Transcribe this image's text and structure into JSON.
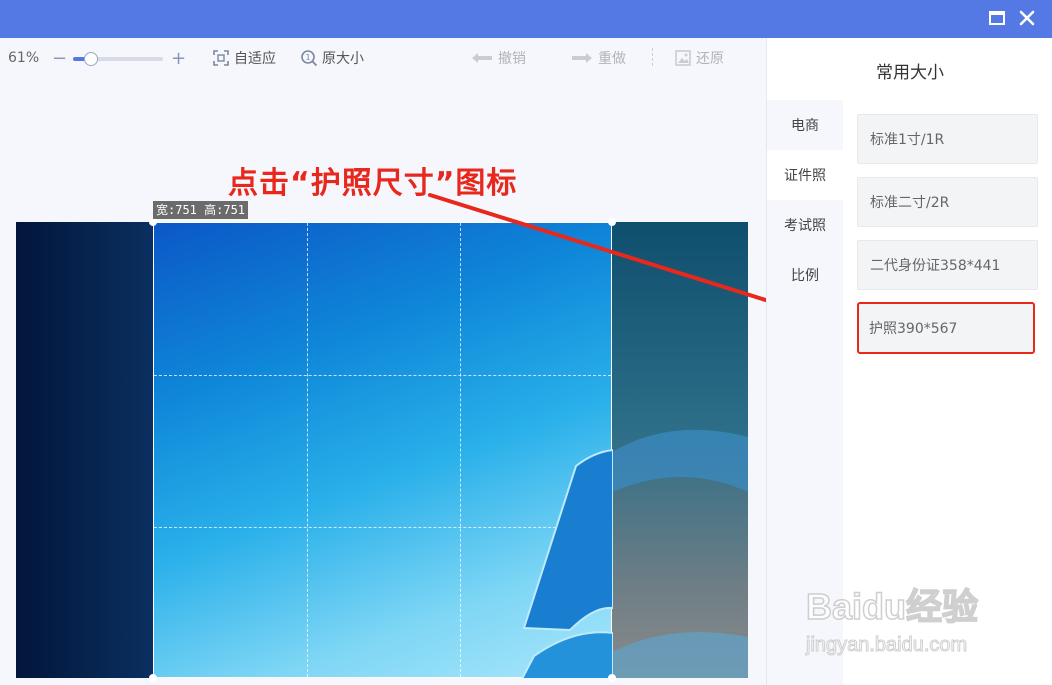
{
  "window": {
    "maximize_icon": "maximize-icon",
    "close_icon": "close-icon"
  },
  "toolbar": {
    "zoom_value": "61%",
    "zoom_fraction": 0.2,
    "zoom_out_symbol": "−",
    "zoom_in_symbol": "+",
    "fit_label": "自适应",
    "original_label": "原大小",
    "undo_label": "撤销",
    "redo_label": "重做",
    "restore_label": "还原"
  },
  "canvas": {
    "crop_size_label": "宽:751 高:751",
    "annotation_text": "点击“护照尺寸”图标",
    "annotation_color": "#e8281d"
  },
  "right_panel": {
    "title": "常用大小",
    "tabs": [
      {
        "label": "电商",
        "active": false
      },
      {
        "label": "证件照",
        "active": true
      },
      {
        "label": "考试照",
        "active": false
      },
      {
        "label": "比例",
        "active": false
      }
    ],
    "sizes": [
      {
        "label": "标准1寸/1R"
      },
      {
        "label": "标准二寸/2R"
      },
      {
        "label": "二代身份证358*441"
      },
      {
        "label": "护照390*567"
      }
    ]
  },
  "watermark": {
    "main": "Baidu经验",
    "sub": "jingyan.baidu.com"
  },
  "colors": {
    "titlebar": "#5478e4",
    "accent": "#5478e4",
    "highlight": "#e8281d"
  }
}
